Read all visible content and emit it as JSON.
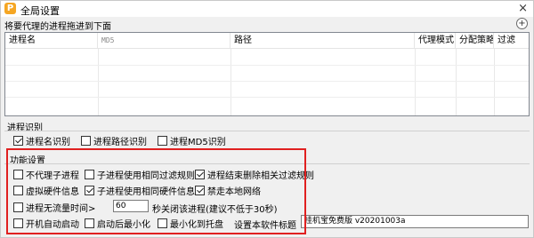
{
  "window": {
    "title": "全局设置",
    "app_icon_glyph": "P",
    "close_glyph": "×"
  },
  "hint_text": "将要代理的进程拖进到下面",
  "add_glyph": "+",
  "list": {
    "columns": [
      "进程名",
      "MD5",
      "路径",
      "代理模式",
      "分配策略",
      "过滤"
    ],
    "rows": []
  },
  "process_id": {
    "title": "进程识别",
    "options": [
      {
        "label": "进程名识别",
        "checked": true
      },
      {
        "label": "进程路径识别",
        "checked": false
      },
      {
        "label": "进程MD5识别",
        "checked": false
      }
    ]
  },
  "features": {
    "title": "功能设置",
    "row1": [
      {
        "label": "不代理子进程",
        "checked": false
      },
      {
        "label": "子进程使用相同过滤规则",
        "checked": false
      },
      {
        "label": "进程结束删除相关过滤规则",
        "checked": true
      }
    ],
    "row2": [
      {
        "label": "虚拟硬件信息",
        "checked": false
      },
      {
        "label": "子进程使用相同硬件信息",
        "checked": true
      },
      {
        "label": "禁走本地网络",
        "checked": true
      }
    ],
    "no_traffic": {
      "label": "进程无流量时间>",
      "checked": false,
      "value": "60",
      "suffix": "秒关闭该进程(建议不低于30秒)"
    },
    "row4": [
      {
        "label": "开机自动启动",
        "checked": false
      },
      {
        "label": "启动后最小化",
        "checked": false
      },
      {
        "label": "最小化到托盘",
        "checked": false
      }
    ],
    "software_title_label": "设置本软件标题",
    "software_title_value": "挂机宝免费版 v20201003a"
  },
  "colors": {
    "highlight": "#e02020"
  }
}
